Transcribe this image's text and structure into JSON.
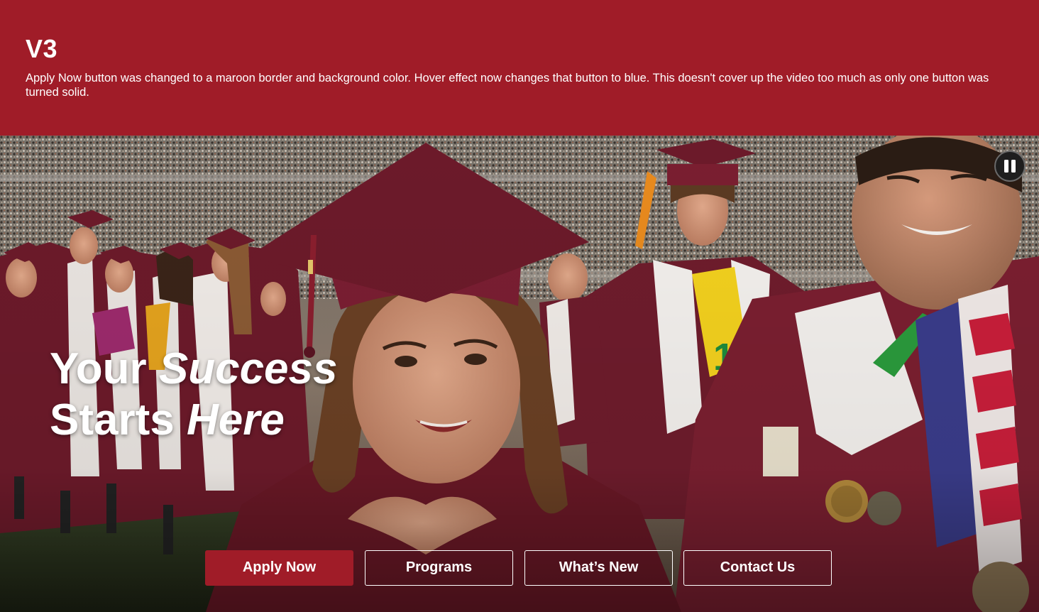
{
  "banner": {
    "title": "V3",
    "description": "Apply Now button was changed to a maroon border and background color. Hover effect now changes that button to blue. This doesn't cover up the video too much as only one button was turned solid.",
    "background_color": "#a01c28"
  },
  "hero": {
    "headline_line1_normal": "Your ",
    "headline_line1_italic": "Success",
    "headline_line2_normal": "Starts ",
    "headline_line2_italic": "Here",
    "pause_icon": "pause-icon"
  },
  "cta": {
    "apply_now": "Apply Now",
    "programs": "Programs",
    "whats_new": "What’s New",
    "contact_us": "Contact Us",
    "primary_color": "#a01c28",
    "outline_color": "#ffffff"
  }
}
